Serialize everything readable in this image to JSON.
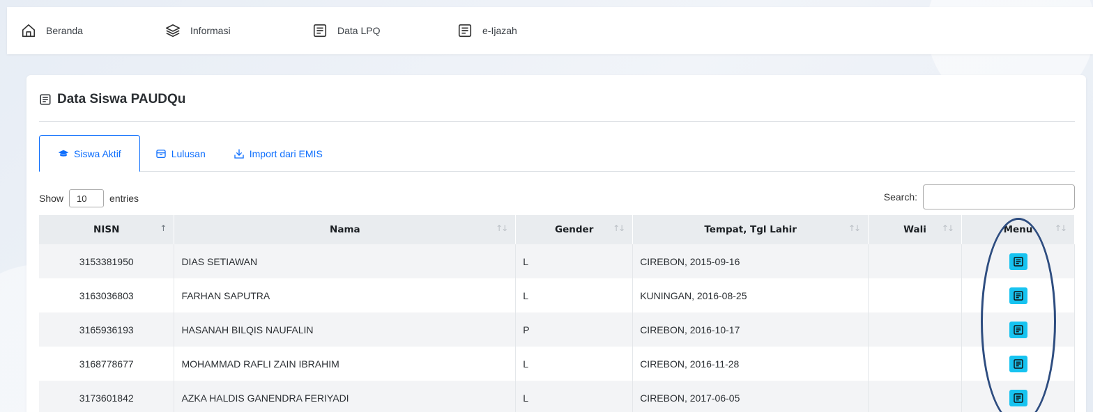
{
  "nav": {
    "items": [
      {
        "label": "Beranda",
        "icon": "home-icon"
      },
      {
        "label": "Informasi",
        "icon": "layers-icon"
      },
      {
        "label": "Data LPQ",
        "icon": "document-icon"
      },
      {
        "label": "e-Ijazah",
        "icon": "document-icon"
      }
    ]
  },
  "card": {
    "title": "Data Siswa PAUDQu"
  },
  "tabs": [
    {
      "label": "Siswa Aktif",
      "icon": "graduation-cap-icon",
      "active": true
    },
    {
      "label": "Lulusan",
      "icon": "archive-icon",
      "active": false
    },
    {
      "label": "Import dari EMIS",
      "icon": "download-icon",
      "active": false
    }
  ],
  "table_controls": {
    "show_label": "Show",
    "entries_value": "10",
    "entries_label": "entries",
    "search_label": "Search:",
    "search_value": ""
  },
  "table": {
    "columns": [
      "NISN",
      "Nama",
      "Gender",
      "Tempat, Tgl Lahir",
      "Wali",
      "Menu"
    ],
    "rows": [
      {
        "nisn": "3153381950",
        "nama": "DIAS SETIAWAN",
        "gender": "L",
        "lahir": "CIREBON, 2015-09-16",
        "wali": ""
      },
      {
        "nisn": "3163036803",
        "nama": "FARHAN SAPUTRA",
        "gender": "L",
        "lahir": "KUNINGAN, 2016-08-25",
        "wali": ""
      },
      {
        "nisn": "3165936193",
        "nama": "HASANAH BILQIS NAUFALIN",
        "gender": "P",
        "lahir": "CIREBON, 2016-10-17",
        "wali": ""
      },
      {
        "nisn": "3168778677",
        "nama": "MOHAMMAD RAFLI ZAIN IBRAHIM",
        "gender": "L",
        "lahir": "CIREBON, 2016-11-28",
        "wali": ""
      },
      {
        "nisn": "3173601842",
        "nama": "AZKA HALDIS GANENDRA FERIYADI",
        "gender": "L",
        "lahir": "CIREBON, 2017-06-05",
        "wali": ""
      }
    ]
  },
  "colors": {
    "accent": "#0d6efd",
    "menu_button": "#17c3f0",
    "annotation": "#2e4d80"
  }
}
